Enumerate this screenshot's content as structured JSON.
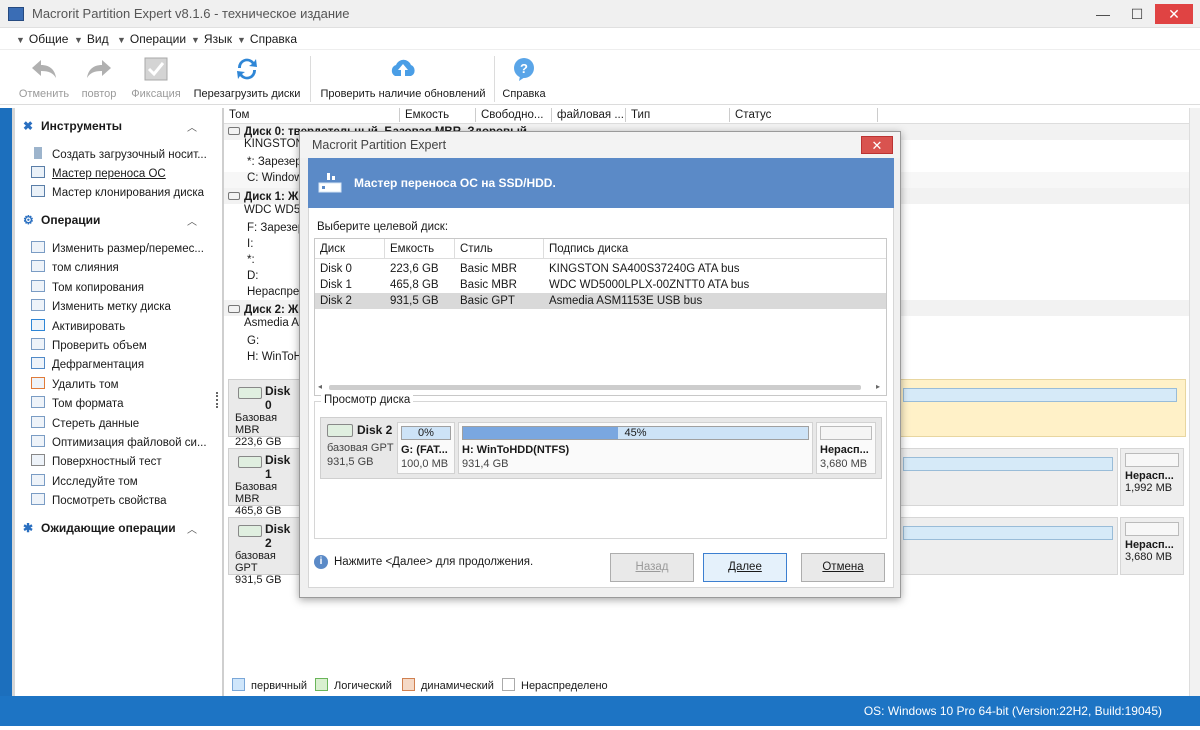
{
  "window": {
    "title": "Macrorit Partition Expert v8.1.6 - техническое издание",
    "minimize": "—",
    "maximize": "☐",
    "close": "✕"
  },
  "menu": [
    "Общие",
    "Вид",
    "Операции",
    "Язык",
    "Справка"
  ],
  "toolbar": {
    "undo": "Отменить",
    "redo": "повтор",
    "commit": "Фиксация",
    "reload": "Перезагрузить диски",
    "check_updates": "Проверить наличие обновлений",
    "help": "Справка"
  },
  "left": {
    "tools_title": "Инструменты",
    "tools": [
      "Создать загрузочный носит...",
      "Мастер переноса ОС",
      "Мастер клонирования диска"
    ],
    "ops_title": "Операции",
    "ops": [
      "Изменить размер/перемес...",
      "том слияния",
      "Том копирования",
      "Изменить метку диска",
      "Активировать",
      "Проверить объем",
      "Дефрагментация",
      "Удалить том",
      "Том формата",
      "Стереть данные",
      "Оптимизация файловой си...",
      "Поверхностный тест",
      "Исследуйте том",
      "Посмотреть свойства"
    ],
    "pending_title": "Ожидающие операции"
  },
  "table": {
    "headers": [
      "Том",
      "Емкость",
      "Свободно...",
      "файловая ...",
      "Тип",
      "Статус"
    ],
    "rows": [
      {
        "text": "Диск 0: твердотельный, Базовая MBR, Здоровый",
        "bold": true
      },
      {
        "text": "KINGSTON",
        "bold": false
      },
      {
        "text": "*: Зарезер",
        "bold": false
      },
      {
        "text": "C: Window",
        "bold": false
      },
      {
        "text": "Диск 1: Ж",
        "bold": true
      },
      {
        "text": "WDC WD50",
        "bold": false
      },
      {
        "text": "F: Зарезер",
        "bold": false
      },
      {
        "text": "I:",
        "bold": false
      },
      {
        "text": "*:",
        "bold": false
      },
      {
        "text": "D:",
        "bold": false
      },
      {
        "text": "Нераспреде",
        "bold": false
      },
      {
        "text": "Диск 2: Ж",
        "bold": true
      },
      {
        "text": "Asmedia AS",
        "bold": false
      },
      {
        "text": "G:",
        "bold": false
      },
      {
        "text": "H: WinToH",
        "bold": false
      }
    ]
  },
  "diskmap": [
    {
      "name": "Disk 0",
      "type": "Базовая MBR",
      "size": "223,6 GB"
    },
    {
      "name": "Disk 1",
      "type": "Базовая MBR",
      "size": "465,8 GB",
      "unalloc_label": "Нерасп...",
      "unalloc_size": "1,992 MB"
    },
    {
      "name": "Disk 2",
      "type": "базовая GPT",
      "size": "931,5 GB",
      "unalloc_label": "Нерасп...",
      "unalloc_size": "3,680 MB"
    }
  ],
  "legend": [
    "первичный",
    "Логический",
    "динамический",
    "Нераспределено"
  ],
  "status": "OS: Windows 10 Pro 64-bit (Version:22H2, Build:19045)",
  "dialog": {
    "title": "Macrorit Partition Expert",
    "close": "✕",
    "banner": "Мастер переноса ОС на SSD/HDD.",
    "select_label": "Выберите целевой диск:",
    "columns": [
      "Диск",
      "Емкость",
      "Стиль",
      "Подпись диска"
    ],
    "disks": [
      {
        "disk": "Disk 0",
        "cap": "223,6 GB",
        "style": "Basic MBR",
        "sig": "KINGSTON SA400S37240G ATA bus"
      },
      {
        "disk": "Disk 1",
        "cap": "465,8 GB",
        "style": "Basic MBR",
        "sig": "WDC WD5000LPLX-00ZNTT0 ATA bus"
      },
      {
        "disk": "Disk 2",
        "cap": "931,5 GB",
        "style": "Basic GPT",
        "sig": "Asmedia ASM1153E USB bus"
      }
    ],
    "preview_label": "Просмотр диска",
    "preview": {
      "disk": "Disk 2",
      "type": "базовая GPT",
      "size": "931,5 GB",
      "parts": [
        {
          "pct": "0%",
          "fill": 0.0,
          "label": "G: (FAT...",
          "size": "100,0 MB"
        },
        {
          "pct": "45%",
          "fill": 0.45,
          "label": "H: WinToHDD(NTFS)",
          "size": "931,4 GB"
        },
        {
          "pct": "",
          "fill": 0.0,
          "label": "Нерасп...",
          "size": "3,680 MB"
        }
      ]
    },
    "hint": "Нажмите <Далее> для продолжения.",
    "back": "Назад",
    "next": "Далее",
    "cancel": "Отмена"
  }
}
